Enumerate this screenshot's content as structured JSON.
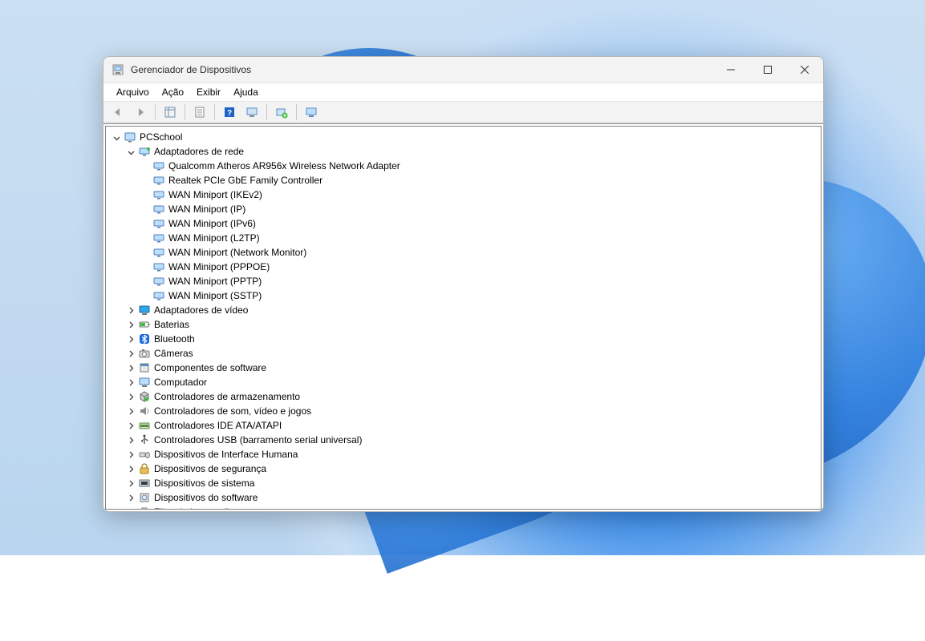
{
  "window": {
    "title": "Gerenciador de Dispositivos"
  },
  "menus": {
    "file": "Arquivo",
    "action": "Ação",
    "view": "Exibir",
    "help": "Ajuda"
  },
  "root": {
    "name": "PCSchool"
  },
  "expanded_category": {
    "name": "Adaptadores de rede",
    "icon": "network-adapter-icon",
    "items": [
      "Qualcomm Atheros AR956x Wireless Network Adapter",
      "Realtek PCIe GbE Family Controller",
      "WAN Miniport (IKEv2)",
      "WAN Miniport (IP)",
      "WAN Miniport (IPv6)",
      "WAN Miniport (L2TP)",
      "WAN Miniport (Network Monitor)",
      "WAN Miniport (PPPOE)",
      "WAN Miniport (PPTP)",
      "WAN Miniport (SSTP)"
    ]
  },
  "categories": [
    {
      "name": "Adaptadores de vídeo",
      "icon": "display-adapter-icon"
    },
    {
      "name": "Baterias",
      "icon": "battery-icon"
    },
    {
      "name": "Bluetooth",
      "icon": "bluetooth-icon"
    },
    {
      "name": "Câmeras",
      "icon": "camera-icon"
    },
    {
      "name": "Componentes de software",
      "icon": "software-component-icon"
    },
    {
      "name": "Computador",
      "icon": "computer-icon"
    },
    {
      "name": "Controladores de armazenamento",
      "icon": "storage-controller-icon"
    },
    {
      "name": "Controladores de som, vídeo e jogos",
      "icon": "sound-controller-icon"
    },
    {
      "name": "Controladores IDE ATA/ATAPI",
      "icon": "ide-controller-icon"
    },
    {
      "name": "Controladores USB (barramento serial universal)",
      "icon": "usb-controller-icon"
    },
    {
      "name": "Dispositivos de Interface Humana",
      "icon": "hid-icon"
    },
    {
      "name": "Dispositivos de segurança",
      "icon": "security-device-icon"
    },
    {
      "name": "Dispositivos de sistema",
      "icon": "system-device-icon"
    },
    {
      "name": "Dispositivos do software",
      "icon": "software-device-icon"
    },
    {
      "name": "Filas de impressão",
      "icon": "print-queue-icon"
    }
  ]
}
